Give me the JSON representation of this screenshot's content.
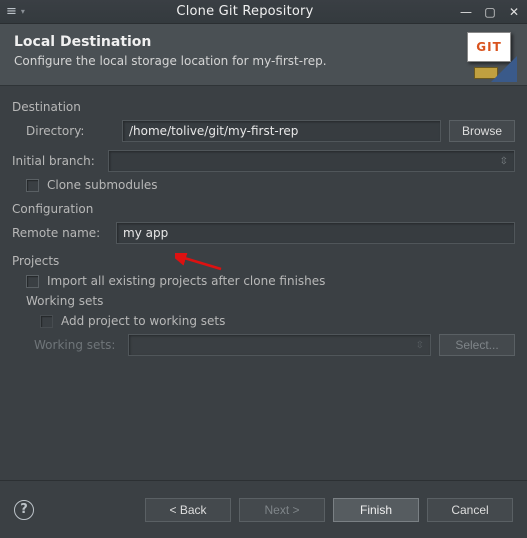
{
  "window": {
    "title": "Clone Git Repository"
  },
  "banner": {
    "title": "Local Destination",
    "subtitle": "Configure the local storage location for my-first-rep.",
    "icon_text": "GIT"
  },
  "destination": {
    "section_label": "Destination",
    "directory_label": "Directory:",
    "directory_value": "/home/tolive/git/my-first-rep",
    "browse_label": "Browse",
    "initial_branch_label": "Initial branch:",
    "initial_branch_value": "",
    "clone_submodules_label": "Clone submodules"
  },
  "configuration": {
    "section_label": "Configuration",
    "remote_name_label": "Remote name:",
    "remote_name_value": "my app"
  },
  "projects": {
    "section_label": "Projects",
    "import_label": "Import all existing projects after clone finishes",
    "working_sets_label": "Working sets",
    "add_label": "Add project to working sets",
    "ws_dropdown_label": "Working sets:",
    "select_label": "Select..."
  },
  "buttons": {
    "help": "?",
    "back": "< Back",
    "next": "Next >",
    "finish": "Finish",
    "cancel": "Cancel"
  }
}
